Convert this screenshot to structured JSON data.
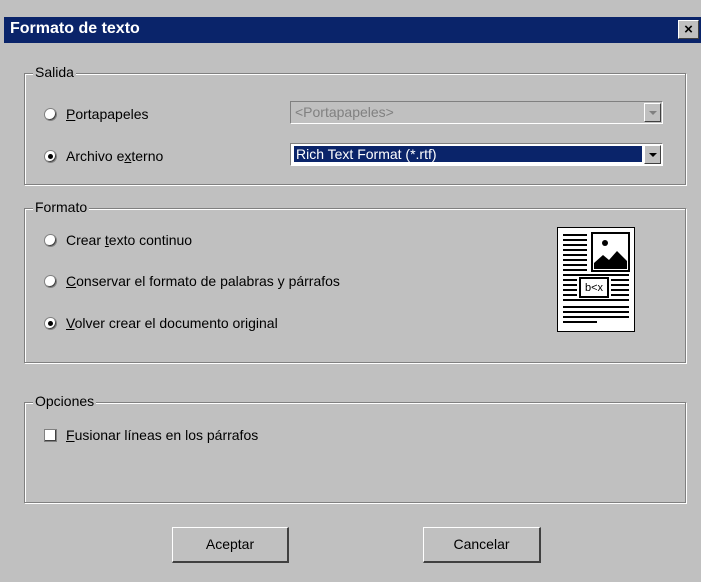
{
  "dialog": {
    "title": "Formato de texto",
    "close_glyph": "×"
  },
  "salida": {
    "legend": "Salida",
    "portapapeles": {
      "accel": "P",
      "rest": "ortapapeles",
      "selected": false
    },
    "archivo": {
      "pre": "Archivo e",
      "accel": "x",
      "post": "terno",
      "selected": true
    },
    "portapapeles_select": {
      "value": "<Portapapeles>",
      "disabled": true
    },
    "archivo_select": {
      "value": "Rich Text Format (*.rtf)"
    }
  },
  "formato": {
    "legend": "Formato",
    "opt1": {
      "pre": "Crear ",
      "accel": "t",
      "post": "exto continuo",
      "selected": false
    },
    "opt2": {
      "pre": "",
      "accel": "C",
      "post": "onservar el formato de palabras y párrafos",
      "selected": false
    },
    "opt3": {
      "pre": "",
      "accel": "V",
      "post": "olver crear el documento original",
      "selected": true
    },
    "icon": "document-layout-icon"
  },
  "opciones": {
    "legend": "Opciones",
    "fusionar": {
      "accel": "F",
      "rest": "usionar líneas en los párrafos",
      "checked": false
    }
  },
  "buttons": {
    "ok": "Aceptar",
    "cancel": "Cancelar"
  }
}
